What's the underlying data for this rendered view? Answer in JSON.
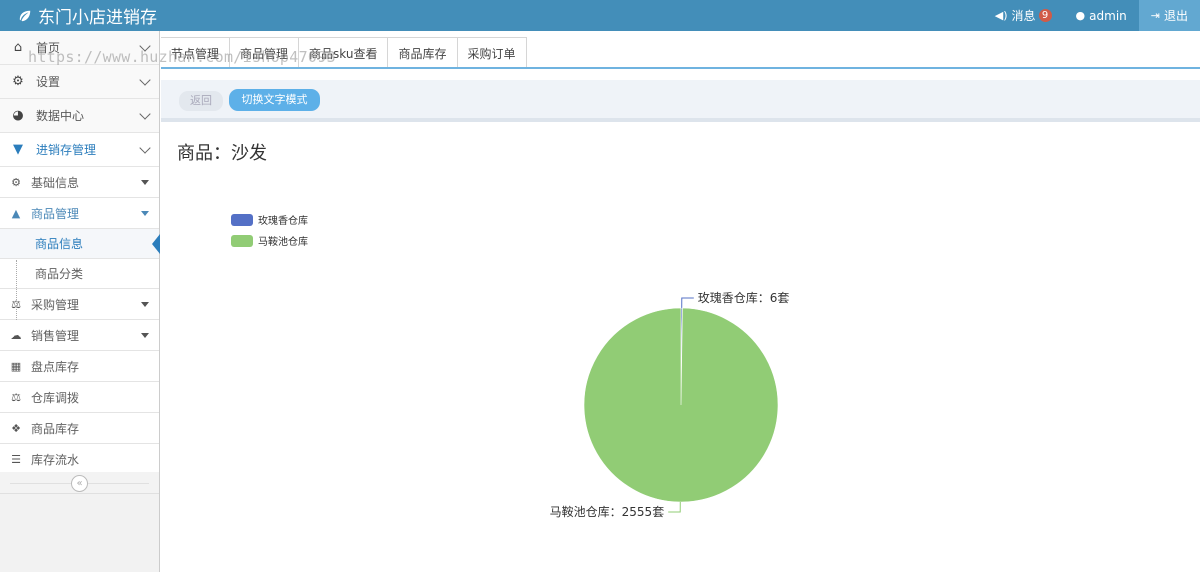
{
  "app": {
    "title": "东门小店进销存"
  },
  "topbar": {
    "messages_label": "消息",
    "messages_count": "9",
    "user": "admin",
    "logout_label": "退出"
  },
  "sidebar": {
    "items": [
      {
        "label": "首页",
        "icon": "home-icon"
      },
      {
        "label": "设置",
        "icon": "gear-icon"
      },
      {
        "label": "数据中心",
        "icon": "pie-chart-icon"
      },
      {
        "label": "进销存管理",
        "icon": "cart-icon"
      }
    ],
    "sub_items": [
      {
        "label": "基础信息",
        "icon": "cogs-icon"
      },
      {
        "label": "商品管理",
        "icon": "bag-icon"
      }
    ],
    "product_children": [
      {
        "label": "商品信息"
      },
      {
        "label": "商品分类"
      }
    ],
    "more_items": [
      {
        "label": "采购管理",
        "icon": "scale-icon"
      },
      {
        "label": "销售管理",
        "icon": "cloud-icon"
      },
      {
        "label": "盘点库存",
        "icon": "grid-icon"
      },
      {
        "label": "仓库调拨",
        "icon": "scale-icon"
      },
      {
        "label": "商品库存",
        "icon": "cubes-icon"
      },
      {
        "label": "库存流水",
        "icon": "list-icon"
      }
    ],
    "collapse_glyph": "«"
  },
  "tabs": [
    "节点管理",
    "商品管理",
    "商品sku查看",
    "商品库存",
    "采购订单"
  ],
  "toolbar": {
    "back_label": "返回",
    "switch_label": "切换文字模式"
  },
  "product": {
    "title": "商品：沙发"
  },
  "watermark": "https://www.huzhan.com/ishop47093",
  "chart_data": {
    "type": "pie",
    "unit": "套",
    "slices": [
      {
        "name": "玫瑰香仓库",
        "value": 6,
        "color": "#5470c6",
        "label": "玫瑰香仓库：6套"
      },
      {
        "name": "马鞍池仓库",
        "value": 2555,
        "color": "#91cc75",
        "label": "马鞍池仓库：2555套"
      }
    ],
    "legend": {
      "placement": "top-left"
    }
  }
}
